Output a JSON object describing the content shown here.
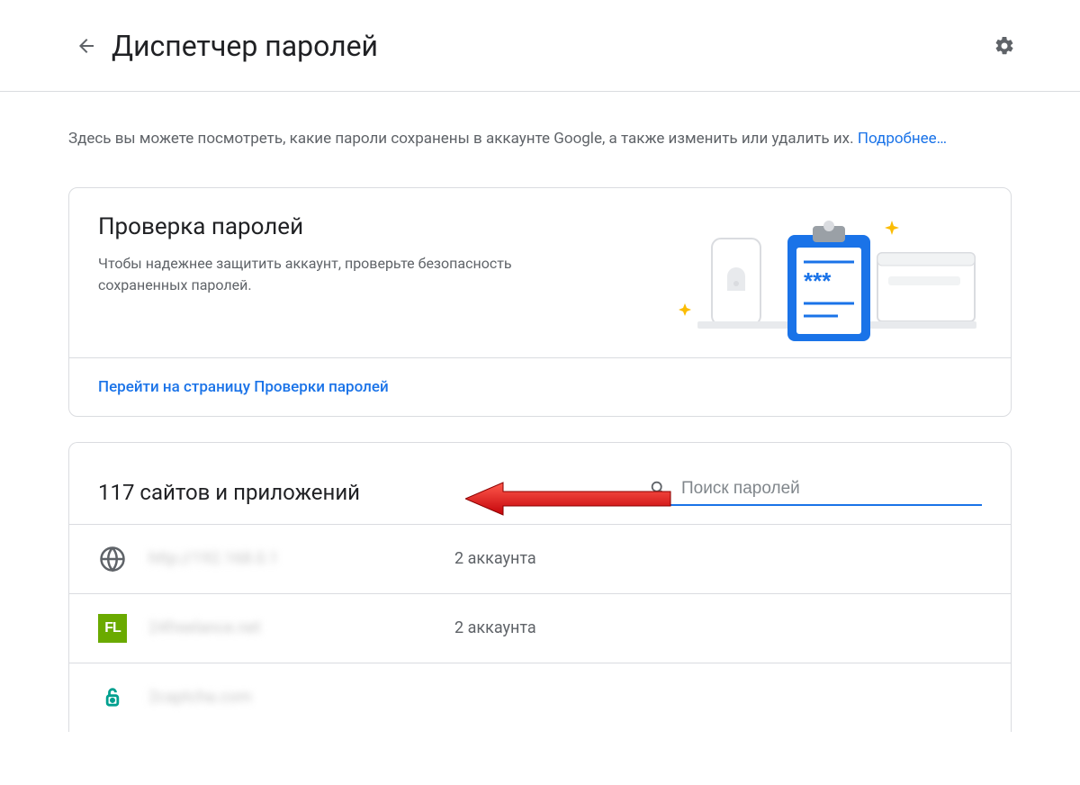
{
  "header": {
    "title": "Диспетчер паролей"
  },
  "intro": {
    "text": "Здесь вы можете посмотреть, какие пароли сохранены в аккаунте Google, а также изменить или удалить их. ",
    "link": "Подробнее…"
  },
  "checkup": {
    "title": "Проверка паролей",
    "desc": "Чтобы надежнее защитить аккаунт, проверьте безопасность сохраненных паролей.",
    "cta": "Перейти на страницу Проверки паролей"
  },
  "list": {
    "heading": "117 сайтов и приложений",
    "search_placeholder": "Поиск паролей",
    "rows": [
      {
        "site": "http://192.168.0.1",
        "accounts": "2 аккаунта"
      },
      {
        "site": "24freelance.net",
        "accounts": "2 аккаунта"
      },
      {
        "site": "2captcha.com",
        "accounts": ""
      }
    ]
  }
}
